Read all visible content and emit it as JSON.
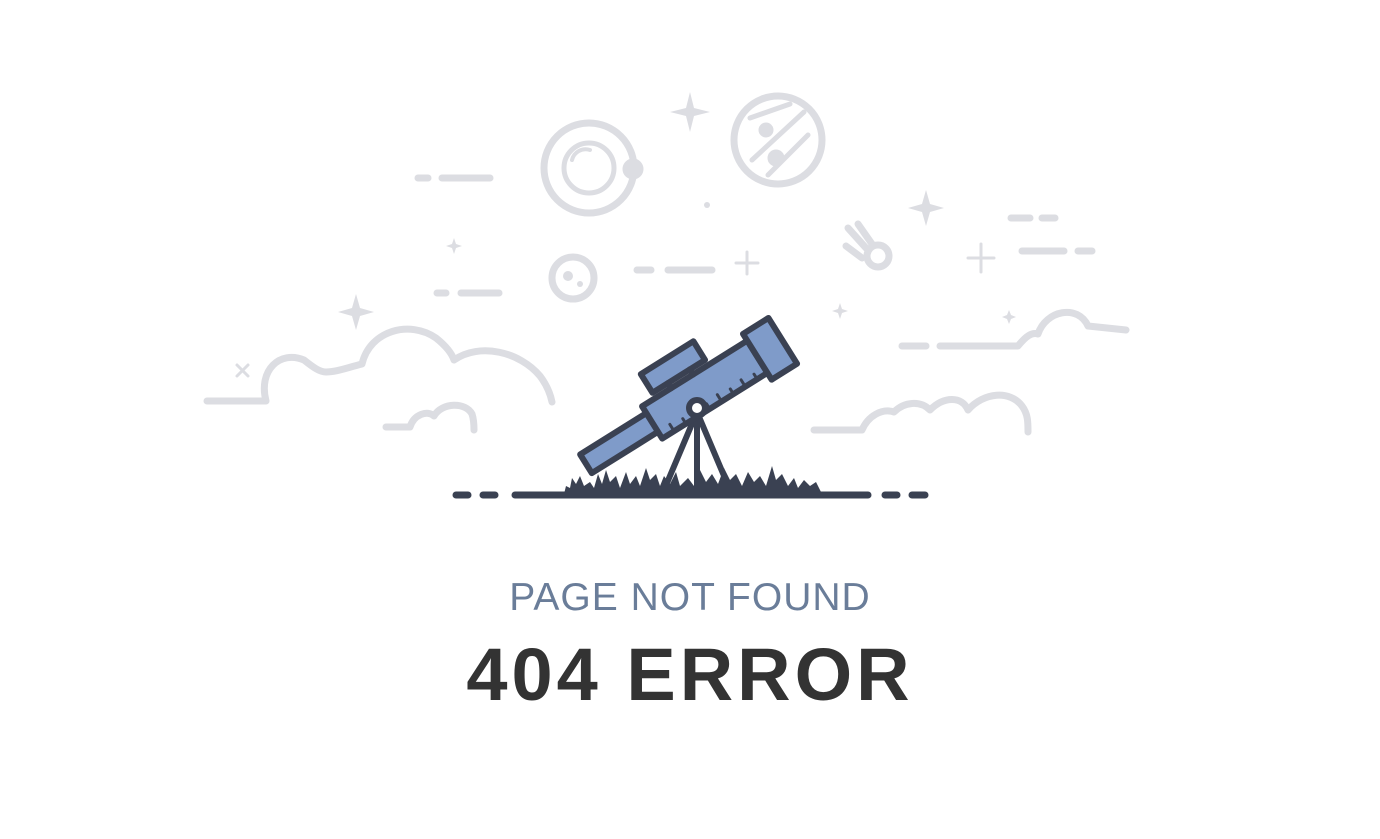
{
  "message": {
    "subtitle": "PAGE NOT FOUND",
    "title": "404 ERROR"
  },
  "illustration": {
    "subject": "telescope-under-night-sky",
    "colors": {
      "outline": "#3a4152",
      "telescope_fill": "#7f9bc9",
      "sky_line": "#dcdde2",
      "subtitle_text": "#6a7d99",
      "title_text": "#333333"
    }
  }
}
